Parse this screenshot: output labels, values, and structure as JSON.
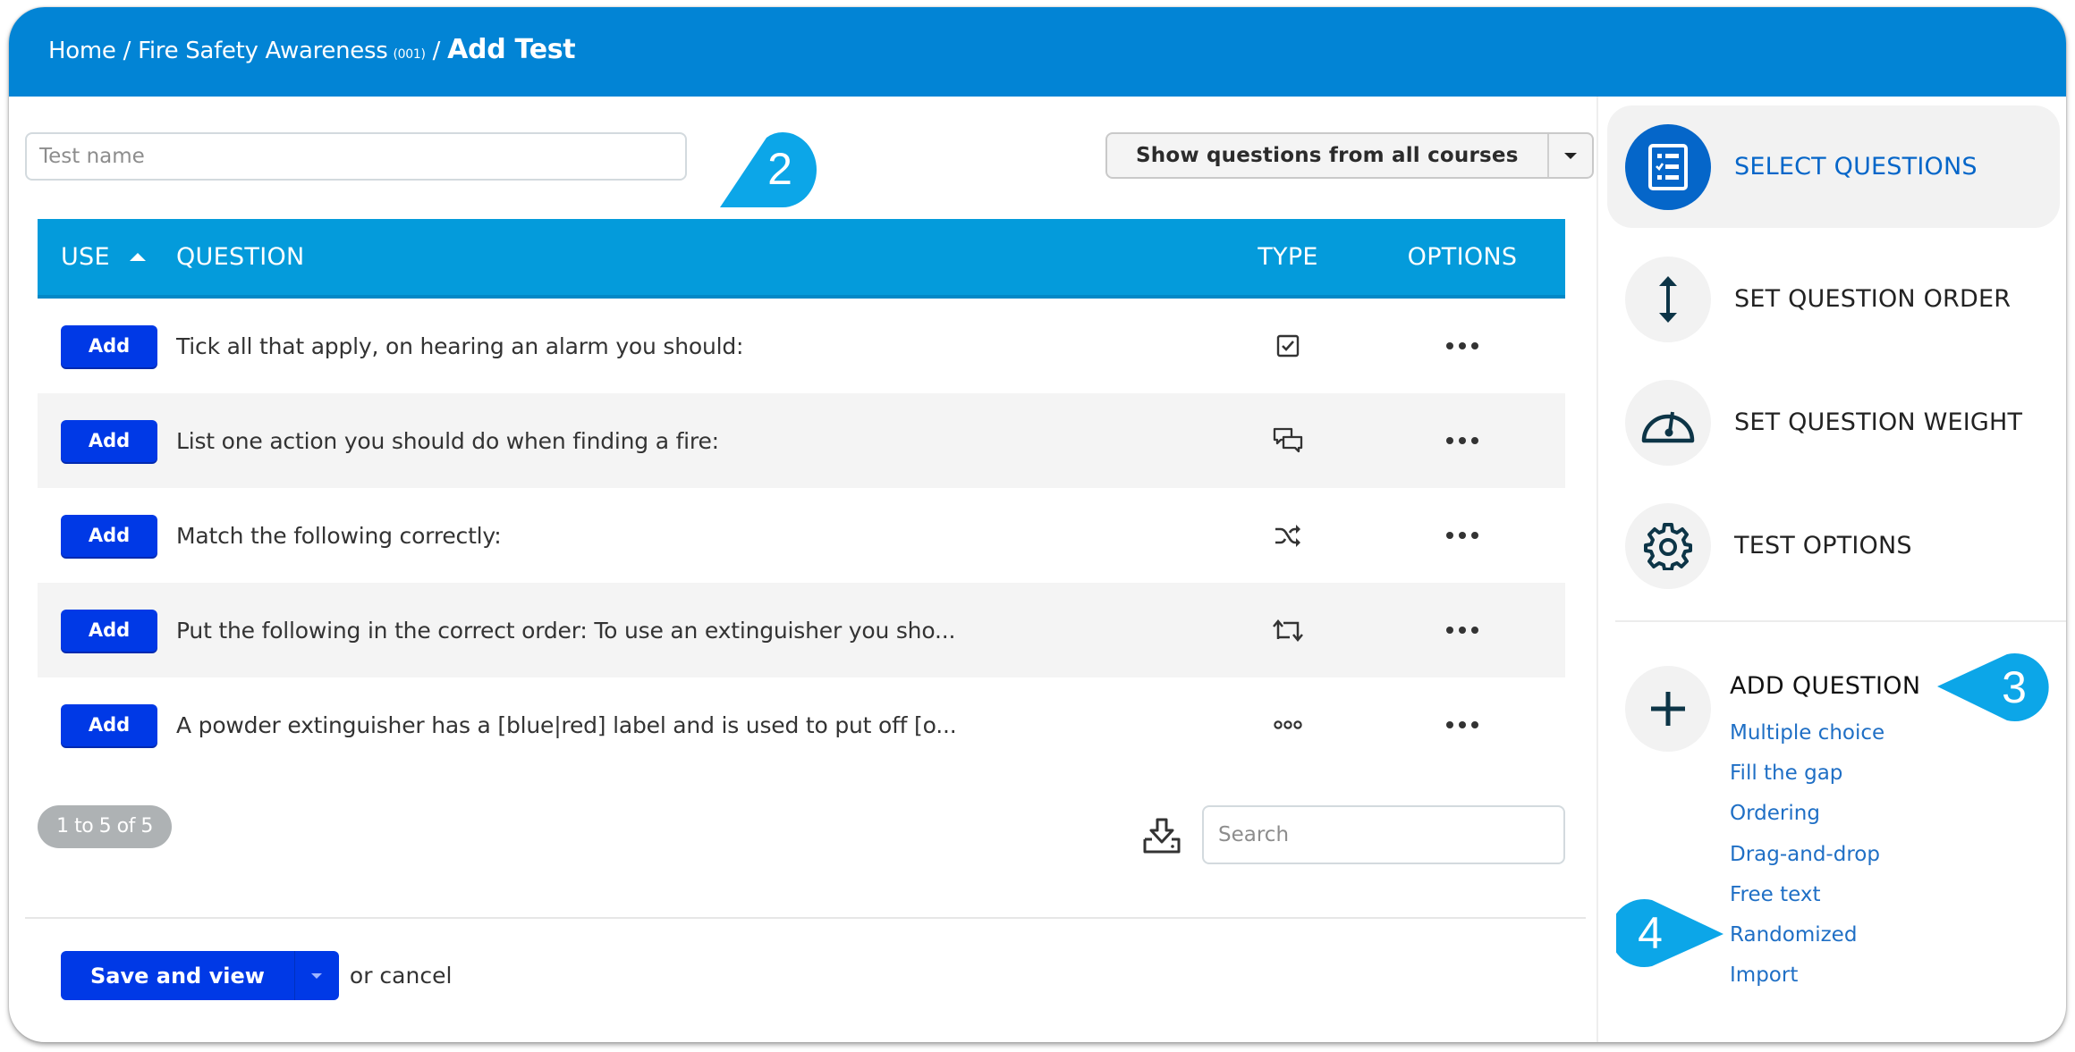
{
  "breadcrumb": {
    "home": "Home",
    "separator": "/",
    "course": "Fire Safety Awareness",
    "course_code": "(001)",
    "current": "Add Test"
  },
  "test_name": {
    "value": "",
    "placeholder": "Test name"
  },
  "course_filter": {
    "selected": "Show questions from all courses",
    "caret_icon": "caret-down-icon"
  },
  "table": {
    "columns": {
      "use": "USE",
      "question": "QUESTION",
      "type": "TYPE",
      "options": "OPTIONS"
    },
    "sort": {
      "column": "USE",
      "direction": "ascending"
    },
    "rows": [
      {
        "action": "Add",
        "question": "Tick all that apply, on hearing an alarm you should:",
        "type_icon": "checkbox-icon",
        "options_icon": "more-horizontal-icon"
      },
      {
        "action": "Add",
        "question": "List one action you should do when finding a fire:",
        "type_icon": "chat-bubbles-icon",
        "options_icon": "more-horizontal-icon"
      },
      {
        "action": "Add",
        "question": "Match the following correctly:",
        "type_icon": "shuffle-icon",
        "options_icon": "more-horizontal-icon"
      },
      {
        "action": "Add",
        "question": "Put the following in the correct order: To use an extinguisher you sho...",
        "type_icon": "reorder-arrows-icon",
        "options_icon": "more-horizontal-icon"
      },
      {
        "action": "Add",
        "question": "A powder extinguisher has a [blue|red] label and is used to put off [o...",
        "type_icon": "fill-gap-dots-icon",
        "options_icon": "more-horizontal-icon"
      }
    ]
  },
  "pagination": {
    "label": "1 to 5 of 5"
  },
  "export_icon": "download-tray-icon",
  "search": {
    "value": "",
    "placeholder": "Search"
  },
  "footer": {
    "save_label": "Save and view",
    "or_cancel": "or cancel"
  },
  "sidebar": {
    "items": [
      {
        "label": "SELECT QUESTIONS",
        "icon": "checklist-icon",
        "active": true
      },
      {
        "label": "SET QUESTION ORDER",
        "icon": "vertical-arrows-icon",
        "active": false
      },
      {
        "label": "SET QUESTION WEIGHT",
        "icon": "gauge-icon",
        "active": false
      },
      {
        "label": "TEST OPTIONS",
        "icon": "gear-icon",
        "active": false
      }
    ],
    "add_question": {
      "title": "ADD QUESTION",
      "icon": "plus-icon",
      "types": [
        "Multiple choice",
        "Fill the gap",
        "Ordering",
        "Drag-and-drop",
        "Free text",
        "Randomized",
        "Import"
      ]
    }
  },
  "callouts": [
    "2",
    "3",
    "4"
  ],
  "colors": {
    "header": "#0284d5",
    "table_header": "#049bdb",
    "primary_button": "#0039e6",
    "active_sidebar": "#0566c9",
    "link": "#1f6fc5",
    "callout": "#0ca6e8"
  }
}
